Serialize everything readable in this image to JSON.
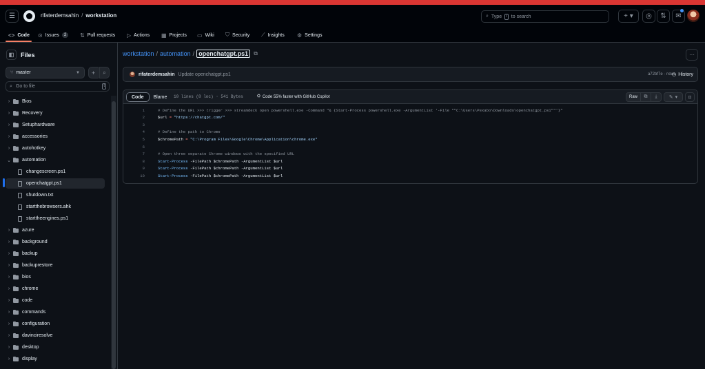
{
  "header": {
    "owner": "rifaterdemsahin",
    "separator": "/",
    "repo": "workstation",
    "search_prefix": "Type",
    "search_key": "/",
    "search_suffix": "to search",
    "plus_icon": "plus-icon",
    "issues_icon": "circle-dot-icon",
    "pr_icon": "git-pull-request-icon",
    "inbox_icon": "inbox-icon"
  },
  "tabs": [
    {
      "label": "Code",
      "icon": "code-icon"
    },
    {
      "label": "Issues",
      "icon": "issue-icon",
      "count": "2"
    },
    {
      "label": "Pull requests",
      "icon": "pull-request-icon"
    },
    {
      "label": "Actions",
      "icon": "play-icon"
    },
    {
      "label": "Projects",
      "icon": "table-icon"
    },
    {
      "label": "Wiki",
      "icon": "book-icon"
    },
    {
      "label": "Security",
      "icon": "shield-icon"
    },
    {
      "label": "Insights",
      "icon": "graph-icon"
    },
    {
      "label": "Settings",
      "icon": "gear-icon"
    }
  ],
  "sidebar": {
    "title": "Files",
    "branch": "master",
    "goto_placeholder": "Go to file",
    "goto_key": "t",
    "items": [
      {
        "label": "Bios",
        "type": "folder",
        "expanded": false
      },
      {
        "label": "Recovery",
        "type": "folder",
        "expanded": false
      },
      {
        "label": "Setuphardware",
        "type": "folder",
        "expanded": false
      },
      {
        "label": "accessories",
        "type": "folder",
        "expanded": false
      },
      {
        "label": "autohotkey",
        "type": "folder",
        "expanded": false
      },
      {
        "label": "automation",
        "type": "folder",
        "expanded": true
      },
      {
        "label": "changescreen.ps1",
        "type": "file"
      },
      {
        "label": "openchatgpt.ps1",
        "type": "file",
        "selected": true
      },
      {
        "label": "shutdown.txt",
        "type": "file"
      },
      {
        "label": "startthebrowsers.ahk",
        "type": "file"
      },
      {
        "label": "starttheengines.ps1",
        "type": "file"
      },
      {
        "label": "azure",
        "type": "folder",
        "expanded": false
      },
      {
        "label": "background",
        "type": "folder",
        "expanded": false
      },
      {
        "label": "backup",
        "type": "folder",
        "expanded": false
      },
      {
        "label": "backuprestore",
        "type": "folder",
        "expanded": false
      },
      {
        "label": "bios",
        "type": "folder",
        "expanded": false
      },
      {
        "label": "chrome",
        "type": "folder",
        "expanded": false
      },
      {
        "label": "code",
        "type": "folder",
        "expanded": false
      },
      {
        "label": "commands",
        "type": "folder",
        "expanded": false
      },
      {
        "label": "configuration",
        "type": "folder",
        "expanded": false
      },
      {
        "label": "davinciresolve",
        "type": "folder",
        "expanded": false
      },
      {
        "label": "desktop",
        "type": "folder",
        "expanded": false
      },
      {
        "label": "display",
        "type": "folder",
        "expanded": false
      }
    ]
  },
  "breadcrumb": {
    "repo": "workstation",
    "folder": "automation",
    "file": "openchatgpt.ps1"
  },
  "commit": {
    "author": "rifaterdemsahin",
    "message": "Update openchatgpt.ps1",
    "meta": "a72bf7e · now",
    "history_label": "History"
  },
  "viewer": {
    "code_tab": "Code",
    "blame_tab": "Blame",
    "file_info": "10 lines (8 loc) · 541 Bytes",
    "copilot": "Code 55% faster with GitHub Copilot",
    "raw_label": "Raw",
    "lines": [
      {
        "n": "1",
        "text": "# Define the URL >>> trigger >>> streamdeck open powershell.exe -Command \"& {Start-Process powershell.exe -ArgumentList '-File \"\"C:\\Users\\Pexabo\\Downloads\\openchatgpt.ps1\"\"'}\""
      },
      {
        "n": "2",
        "text": "$url = \"https://chatgpt.com/\""
      },
      {
        "n": "3",
        "text": ""
      },
      {
        "n": "4",
        "text": "# Define the path to Chrome"
      },
      {
        "n": "5",
        "text": "$chromePath = \"C:\\Program Files\\Google\\Chrome\\Application\\chrome.exe\""
      },
      {
        "n": "6",
        "text": ""
      },
      {
        "n": "7",
        "text": "# Open three separate Chrome windows with the specified URL"
      },
      {
        "n": "8",
        "text": "Start-Process -FilePath $chromePath -ArgumentList $url"
      },
      {
        "n": "9",
        "text": "Start-Process -FilePath $chromePath -ArgumentList $url"
      },
      {
        "n": "10",
        "text": "Start-Process -FilePath $chromePath -ArgumentList $url"
      }
    ]
  },
  "colors": {
    "accent_bar": "#da3633",
    "link": "#4493f8",
    "tab_underline": "#f78166"
  }
}
